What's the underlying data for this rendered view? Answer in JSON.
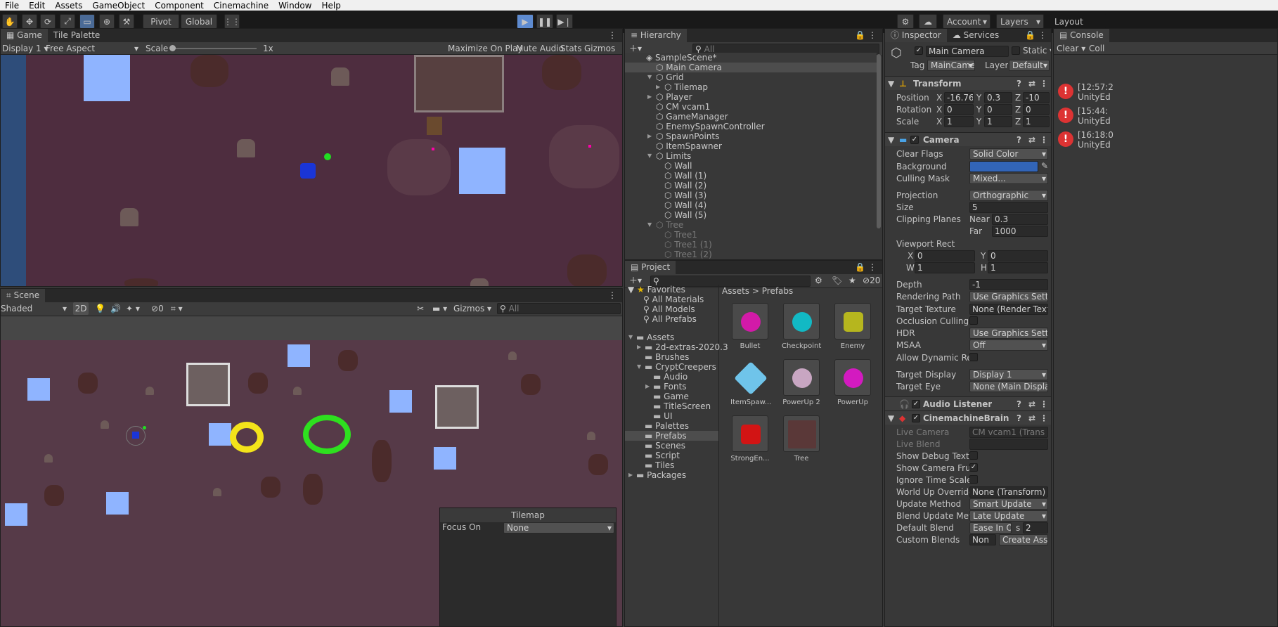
{
  "menu": [
    "File",
    "Edit",
    "Assets",
    "GameObject",
    "Component",
    "Cinemachine",
    "Window",
    "Help"
  ],
  "toolbar": {
    "pivot": "Pivot",
    "global": "Global",
    "account": "Account",
    "layers": "Layers",
    "layout": "Layout"
  },
  "game": {
    "tabs": [
      "Game",
      "Tile Palette"
    ],
    "display": "Display 1",
    "aspect": "Free Aspect",
    "scale_label": "Scale",
    "scale_value": "1x",
    "maximize": "Maximize On Play",
    "mute": "Mute Audio",
    "stats": "Stats",
    "gizmos": "Gizmos"
  },
  "scene": {
    "tab": "Scene",
    "shading": "Shaded",
    "mode2d": "2D",
    "hidden_count": "0",
    "gizmos": "Gizmos",
    "search_placeholder": "All",
    "tilemap_overlay": {
      "title": "Tilemap",
      "focus_label": "Focus On",
      "focus_value": "None"
    }
  },
  "hierarchy": {
    "tab": "Hierarchy",
    "search_placeholder": "All",
    "scene": "SampleScene*",
    "items": [
      {
        "label": "Main Camera",
        "indent": 1,
        "selected": true,
        "dim": false,
        "arrow": ""
      },
      {
        "label": "Grid",
        "indent": 1,
        "dim": false,
        "arrow": "▼"
      },
      {
        "label": "Tilemap",
        "indent": 2,
        "dim": false,
        "arrow": "▶"
      },
      {
        "label": "Player",
        "indent": 1,
        "dim": false,
        "arrow": "▶"
      },
      {
        "label": "CM vcam1",
        "indent": 1,
        "dim": false,
        "arrow": ""
      },
      {
        "label": "GameManager",
        "indent": 1,
        "dim": false,
        "arrow": ""
      },
      {
        "label": "EnemySpawnController",
        "indent": 1,
        "dim": false,
        "arrow": ""
      },
      {
        "label": "SpawnPoints",
        "indent": 1,
        "dim": false,
        "arrow": "▶"
      },
      {
        "label": "ItemSpawner",
        "indent": 1,
        "dim": false,
        "arrow": ""
      },
      {
        "label": "Limits",
        "indent": 1,
        "dim": false,
        "arrow": "▼"
      },
      {
        "label": "Wall",
        "indent": 2,
        "dim": false,
        "arrow": ""
      },
      {
        "label": "Wall (1)",
        "indent": 2,
        "dim": false,
        "arrow": ""
      },
      {
        "label": "Wall (2)",
        "indent": 2,
        "dim": false,
        "arrow": ""
      },
      {
        "label": "Wall (3)",
        "indent": 2,
        "dim": false,
        "arrow": ""
      },
      {
        "label": "Wall (4)",
        "indent": 2,
        "dim": false,
        "arrow": ""
      },
      {
        "label": "Wall (5)",
        "indent": 2,
        "dim": false,
        "arrow": ""
      },
      {
        "label": "Tree",
        "indent": 1,
        "dim": true,
        "arrow": "▼"
      },
      {
        "label": "Tree1",
        "indent": 2,
        "dim": true,
        "arrow": ""
      },
      {
        "label": "Tree1 (1)",
        "indent": 2,
        "dim": true,
        "arrow": ""
      },
      {
        "label": "Tree1 (2)",
        "indent": 2,
        "dim": true,
        "arrow": ""
      }
    ]
  },
  "project": {
    "tab": "Project",
    "hidden_count": "20",
    "favorites": "Favorites",
    "fav_items": [
      "All Materials",
      "All Models",
      "All Prefabs"
    ],
    "tree": [
      {
        "label": "Assets",
        "indent": 0,
        "arrow": "▼"
      },
      {
        "label": "2d-extras-2020.3",
        "indent": 1,
        "arrow": "▶"
      },
      {
        "label": "Brushes",
        "indent": 1,
        "arrow": ""
      },
      {
        "label": "CryptCreepers",
        "indent": 1,
        "arrow": "▼"
      },
      {
        "label": "Audio",
        "indent": 2,
        "arrow": ""
      },
      {
        "label": "Fonts",
        "indent": 2,
        "arrow": "▶"
      },
      {
        "label": "Game",
        "indent": 2,
        "arrow": ""
      },
      {
        "label": "TitleScreen",
        "indent": 2,
        "arrow": ""
      },
      {
        "label": "UI",
        "indent": 2,
        "arrow": ""
      },
      {
        "label": "Palettes",
        "indent": 1,
        "arrow": ""
      },
      {
        "label": "Prefabs",
        "indent": 1,
        "arrow": "",
        "selected": true
      },
      {
        "label": "Scenes",
        "indent": 1,
        "arrow": ""
      },
      {
        "label": "Script",
        "indent": 1,
        "arrow": ""
      },
      {
        "label": "Tiles",
        "indent": 1,
        "arrow": ""
      },
      {
        "label": "Packages",
        "indent": 0,
        "arrow": "▶"
      }
    ],
    "breadcrumb": [
      "Assets",
      "Prefabs"
    ],
    "prefabs": [
      {
        "label": "Bullet",
        "color": "#d21aa8",
        "shape": "circle"
      },
      {
        "label": "Checkpoint",
        "color": "#12b9c4",
        "shape": "circle"
      },
      {
        "label": "Enemy",
        "color": "#b6b61e",
        "shape": "rounded"
      },
      {
        "label": "ItemSpaw...",
        "color": "#6fc4ea",
        "shape": "cube"
      },
      {
        "label": "PowerUp 2",
        "color": "#c8a6c2",
        "shape": "circle"
      },
      {
        "label": "PowerUp",
        "color": "#d31ac0",
        "shape": "circle"
      },
      {
        "label": "StrongEn...",
        "color": "#d21414",
        "shape": "rounded"
      },
      {
        "label": "Tree",
        "color": "#5a3838",
        "shape": "image"
      }
    ]
  },
  "inspector": {
    "tabs": [
      "Inspector",
      "Services"
    ],
    "name": "Main Camera",
    "static": "Static",
    "tag_label": "Tag",
    "tag": "MainCame",
    "layer_label": "Layer",
    "layer": "Default",
    "transform": {
      "title": "Transform",
      "position_label": "Position",
      "rotation_label": "Rotation",
      "scale_label": "Scale",
      "px": "-16.763",
      "py": "0.3",
      "pz": "-10",
      "rx": "0",
      "ry": "0",
      "rz": "0",
      "sx": "1",
      "sy": "1",
      "sz": "1"
    },
    "camera": {
      "title": "Camera",
      "clear_flags_label": "Clear Flags",
      "clear_flags": "Solid Color",
      "background_label": "Background",
      "background_color": "#3265b8",
      "culling_label": "Culling Mask",
      "culling": "Mixed...",
      "projection_label": "Projection",
      "projection": "Orthographic",
      "size_label": "Size",
      "size": "5",
      "clipping_label": "Clipping Planes",
      "near_label": "Near",
      "near": "0.3",
      "far_label": "Far",
      "far": "1000",
      "viewport_label": "Viewport Rect",
      "vx": "0",
      "vy": "0",
      "vw": "1",
      "vh": "1",
      "depth_label": "Depth",
      "depth": "-1",
      "rendering_label": "Rendering Path",
      "rendering": "Use Graphics Settin",
      "target_texture_label": "Target Texture",
      "target_texture": "None (Render Textu",
      "occlusion_label": "Occlusion Culling",
      "hdr_label": "HDR",
      "hdr": "Use Graphics Settin",
      "msaa_label": "MSAA",
      "msaa": "Off",
      "dynres_label": "Allow Dynamic Resol",
      "target_display_label": "Target Display",
      "target_display": "Display 1",
      "target_eye_label": "Target Eye",
      "target_eye": "None (Main Display"
    },
    "audio_listener": "Audio Listener",
    "brain": {
      "title": "CinemachineBrain",
      "live_camera_label": "Live Camera",
      "live_camera": "CM vcam1 (Trans",
      "live_blend_label": "Live Blend",
      "debug_label": "Show Debug Text",
      "frustum_label": "Show Camera Frustu",
      "ignore_label": "Ignore Time Scale",
      "worldup_label": "World Up Override",
      "worldup": "None (Transform)",
      "update_label": "Update Method",
      "update": "Smart Update",
      "blend_update_label": "Blend Update Metho",
      "blend_update": "Late Update",
      "default_blend_label": "Default Blend",
      "default_blend": "Ease In O",
      "default_blend_s": "2",
      "custom_label": "Custom Blends",
      "custom": "Non",
      "create_asset": "Create Asset"
    }
  },
  "console": {
    "tab": "Console",
    "clear": "Clear",
    "collapse": "Coll",
    "entries": [
      {
        "time": "[12:57:2",
        "src": "UnityEd"
      },
      {
        "time": "[15:44:",
        "src": "UnityEd"
      },
      {
        "time": "[16:18:0",
        "src": "UnityEd"
      }
    ]
  }
}
